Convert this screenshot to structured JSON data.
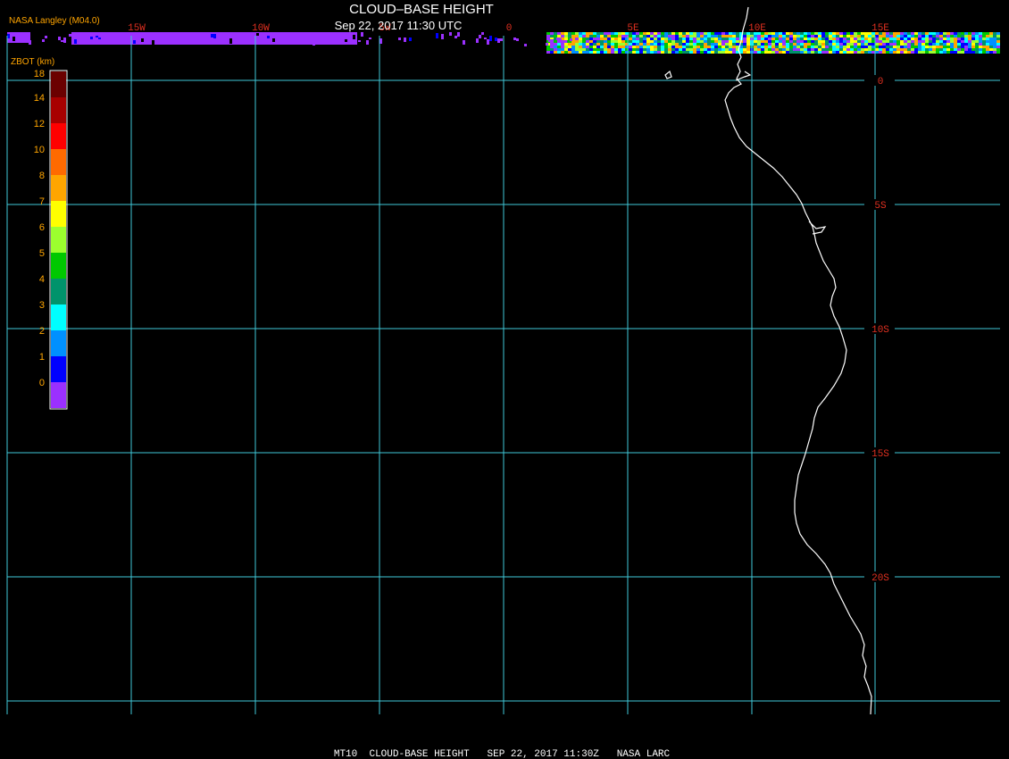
{
  "header": {
    "source": "NASA Langley (M04.0)",
    "title": "CLOUD–BASE HEIGHT",
    "timestamp": "Sep 22, 2017 11:30 UTC"
  },
  "footer": {
    "caption": "MT10  CLOUD-BASE HEIGHT   SEP 22, 2017 11:30Z   NASA LARC"
  },
  "legend": {
    "title": "ZBOT (km)",
    "levels": [
      {
        "label": "18",
        "color": "#6b0000"
      },
      {
        "label": "14",
        "color": "#a80000"
      },
      {
        "label": "12",
        "color": "#ff0000"
      },
      {
        "label": "10",
        "color": "#ff6a00"
      },
      {
        "label": "8",
        "color": "#ffa500"
      },
      {
        "label": "7",
        "color": "#ffff00"
      },
      {
        "label": "6",
        "color": "#9cff2e"
      },
      {
        "label": "5",
        "color": "#00c800"
      },
      {
        "label": "4",
        "color": "#00936b"
      },
      {
        "label": "3",
        "color": "#00ffff"
      },
      {
        "label": "2",
        "color": "#0090ff"
      },
      {
        "label": "1",
        "color": "#0000ff"
      },
      {
        "label": "0",
        "color": "#9b30ff"
      }
    ]
  },
  "map": {
    "longitude_labels": [
      "15W",
      "10W",
      "5W",
      "0",
      "5E",
      "10E",
      "15E"
    ],
    "latitude_labels": [
      "0",
      "5S",
      "10S",
      "15S",
      "20S"
    ],
    "grid_color": "#40c8d8",
    "label_color": "#e03020",
    "coastline_color": "#ffffff"
  }
}
